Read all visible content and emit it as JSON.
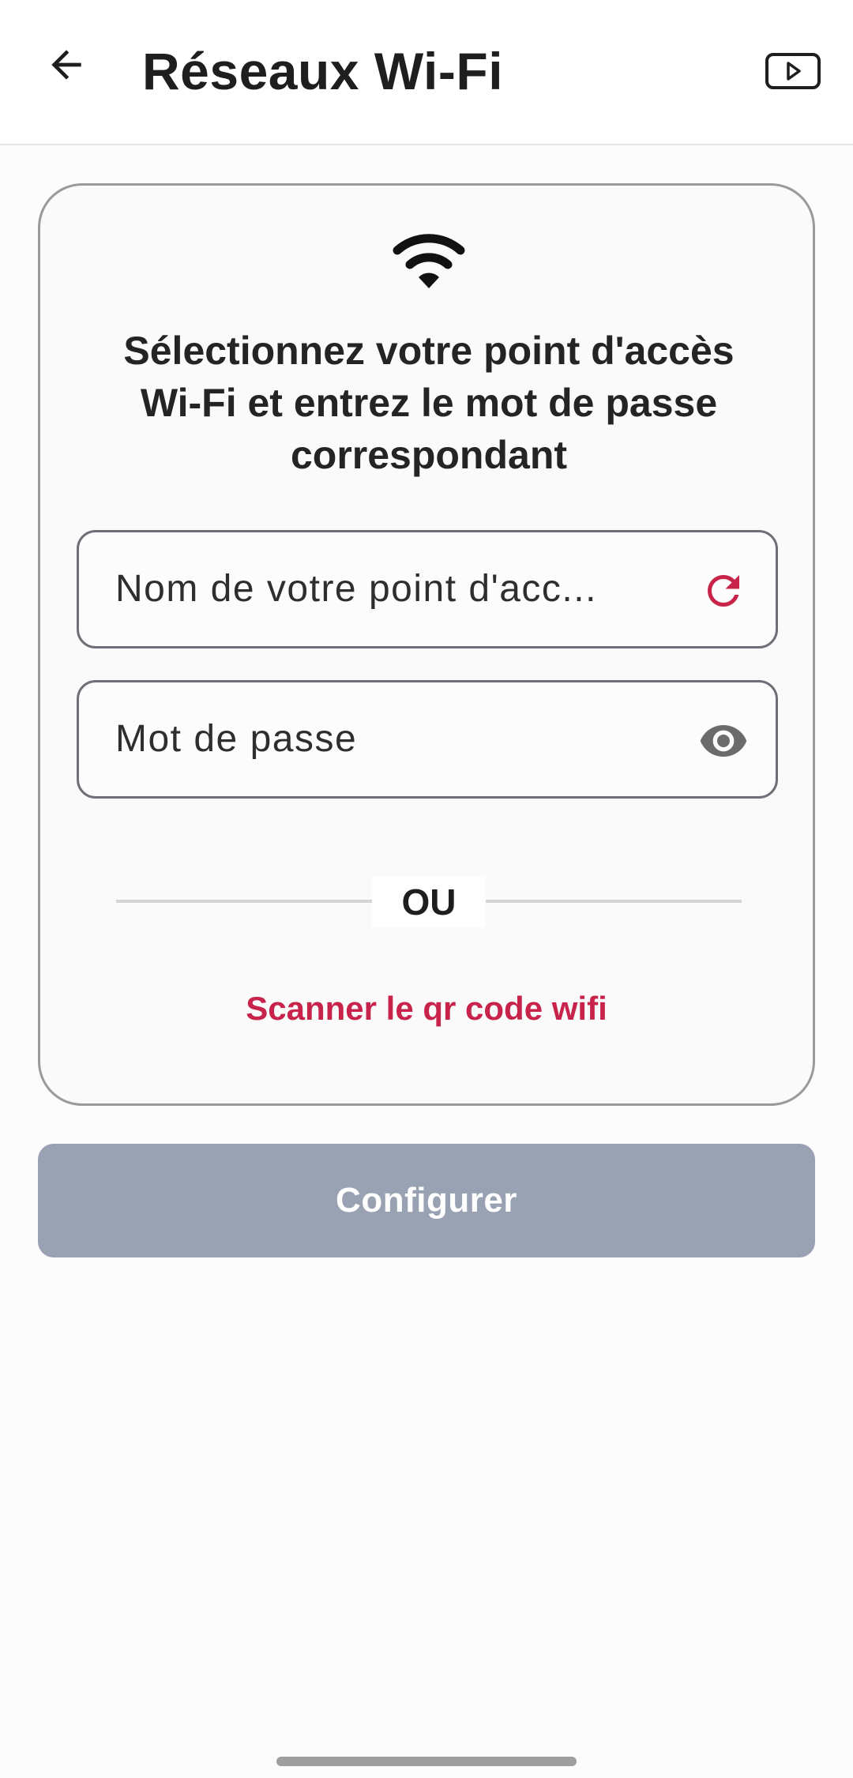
{
  "header": {
    "title": "Réseaux Wi-Fi",
    "back_icon": "arrow-left-icon",
    "video_icon": "video-play-icon"
  },
  "card": {
    "icon": "wifi-icon",
    "heading": "Sélectionnez votre point d'accès Wi-Fi et entrez le mot de passe correspondant",
    "ssid_field": {
      "placeholder": "Nom de votre point d'acc...",
      "value": "",
      "icon": "refresh-icon"
    },
    "password_field": {
      "placeholder": "Mot de passe",
      "value": "",
      "icon": "eye-icon"
    },
    "divider_text": "OU",
    "scan_link": "Scanner le qr code wifi"
  },
  "configure_button": "Configurer",
  "colors": {
    "accent": "#c8234a",
    "button_disabled": "#98a2b3",
    "card_border": "#9a9a9a"
  }
}
